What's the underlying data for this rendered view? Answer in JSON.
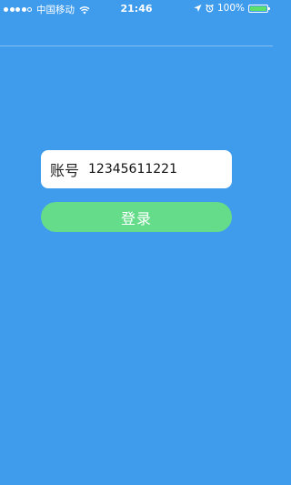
{
  "status_bar": {
    "carrier": "中国移动",
    "time": "21:46",
    "battery_percent": "100%",
    "battery_level": 1.0,
    "icons": [
      "signal-dots",
      "wifi-icon",
      "location-arrow-icon",
      "alarm-icon",
      "battery-icon"
    ]
  },
  "login_form": {
    "account_label": "账号",
    "account_value": "12345611221",
    "login_label": "登录"
  },
  "colors": {
    "background": "#3f9cec",
    "field_background": "#ffffff",
    "button_background": "#64dc8a",
    "battery_fill": "#5de06b"
  }
}
